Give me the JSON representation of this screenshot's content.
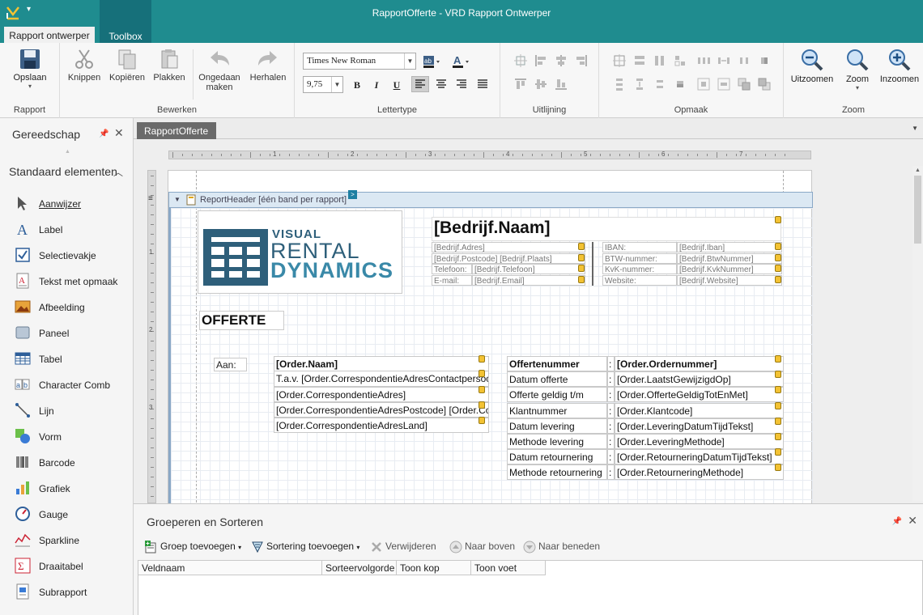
{
  "window": {
    "title": "RapportOfferte - VRD Rapport Ontwerper",
    "quick_access": "▾"
  },
  "tabs": [
    {
      "label": "Rapport ontwerper"
    },
    {
      "label": "Toolbox"
    }
  ],
  "ribbon": {
    "groups": {
      "rapport": "Rapport",
      "bewerken": "Bewerken",
      "lettertype": "Lettertype",
      "uitlijning": "Uitlijning",
      "opmaak": "Opmaak",
      "zoom": "Zoom"
    },
    "buttons": {
      "opslaan": "Opslaan",
      "knippen": "Knippen",
      "kopieren": "Kopiëren",
      "plakken": "Plakken",
      "ongedaan_line1": "Ongedaan",
      "ongedaan_line2": "maken",
      "herhalen": "Herhalen",
      "uitzoomen": "Uitzoomen",
      "zoom": "Zoom",
      "inzoomen": "Inzoomen"
    },
    "font": {
      "family": "Times New Roman",
      "size": "9,75"
    },
    "format": {
      "bold": "B",
      "italic": "I",
      "underline": "U"
    }
  },
  "toolbox": {
    "title": "Gereedschap",
    "section": "Standaard elementen",
    "items": [
      {
        "label": "Aanwijzer",
        "icon": "pointer-icon"
      },
      {
        "label": "Label",
        "icon": "label-icon"
      },
      {
        "label": "Selectievakje",
        "icon": "checkbox-icon"
      },
      {
        "label": "Tekst met opmaak",
        "icon": "richtext-icon"
      },
      {
        "label": "Afbeelding",
        "icon": "image-icon"
      },
      {
        "label": "Paneel",
        "icon": "panel-icon"
      },
      {
        "label": "Tabel",
        "icon": "table-icon"
      },
      {
        "label": "Character Comb",
        "icon": "charcomb-icon"
      },
      {
        "label": "Lijn",
        "icon": "line-icon"
      },
      {
        "label": "Vorm",
        "icon": "shape-icon"
      },
      {
        "label": "Barcode",
        "icon": "barcode-icon"
      },
      {
        "label": "Grafiek",
        "icon": "chart-icon"
      },
      {
        "label": "Gauge",
        "icon": "gauge-icon"
      },
      {
        "label": "Sparkline",
        "icon": "sparkline-icon"
      },
      {
        "label": "Draaitabel",
        "icon": "pivot-icon"
      },
      {
        "label": "Subrapport",
        "icon": "subreport-icon"
      }
    ]
  },
  "document": {
    "tab": "RapportOfferte",
    "band_header": "ReportHeader [één band per rapport]",
    "ruler_h": [
      "1",
      "2",
      "3",
      "4",
      "5",
      "6",
      "7"
    ],
    "ruler_v": [
      "1",
      "2",
      "3"
    ],
    "logo": {
      "line1": "VISUAL",
      "line2": "RENTAL",
      "line3": "DYNAMICS"
    },
    "company_name": "[Bedrijf.Naam]",
    "company_left": [
      {
        "a": "[Bedrijf.Adres]",
        "b": ""
      },
      {
        "a": "[Bedrijf.Postcode] [Bedrijf.Plaats]",
        "b": ""
      },
      {
        "a": "Telefoon:",
        "b": "[Bedrijf.Telefoon]"
      },
      {
        "a": "E-mail:",
        "b": "[Bedrijf.Email]"
      }
    ],
    "company_right": [
      {
        "a": "IBAN:",
        "b": "[Bedrijf.Iban]"
      },
      {
        "a": "BTW-nummer:",
        "b": "[Bedrijf.BtwNummer]"
      },
      {
        "a": "KvK-nummer:",
        "b": "[Bedrijf.KvkNummer]"
      },
      {
        "a": "Website:",
        "b": "[Bedrijf.Website]"
      }
    ],
    "offerte_title": "OFFERTE",
    "aan_label": "Aan:",
    "address": [
      "[Order.Naam]",
      "T.a.v.  [Order.CorrespondentieAdresContactpersoon]",
      "[Order.CorrespondentieAdres]",
      "[Order.CorrespondentieAdresPostcode]  [Order.CorrespondentieAdresPlaats]",
      "[Order.CorrespondentieAdresLand]"
    ],
    "details": [
      {
        "label": "Offertenummer",
        "value": "[Order.Ordernummer]"
      },
      {
        "label": "Datum offerte",
        "value": "[Order.LaatstGewijzigdOp]"
      },
      {
        "label": "Offerte geldig t/m",
        "value": "[Order.OfferteGeldigTotEnMet]"
      },
      {
        "label": "Klantnummer",
        "value": "[Order.Klantcode]"
      },
      {
        "label": "Datum levering",
        "value": "[Order.LeveringDatumTijdTekst]"
      },
      {
        "label": "Methode levering",
        "value": "[Order.LeveringMethode]"
      },
      {
        "label": "Datum retournering",
        "value": "[Order.RetourneringDatumTijdTekst]"
      },
      {
        "label": "Methode retournering",
        "value": "[Order.RetourneringMethode]"
      }
    ],
    "colon": ":"
  },
  "group_sort": {
    "title": "Groeperen en Sorteren",
    "buttons": {
      "add_group": "Groep toevoegen",
      "add_sort": "Sortering toevoegen",
      "delete": "Verwijderen",
      "up": "Naar boven",
      "down": "Naar beneden"
    },
    "columns": [
      "Veldnaam",
      "Sorteervolgorde",
      "Toon kop",
      "Toon voet"
    ]
  },
  "colors": {
    "accent": "#1f8c8f",
    "band": "#dbe8f3",
    "logo": "#2e5f7a"
  }
}
